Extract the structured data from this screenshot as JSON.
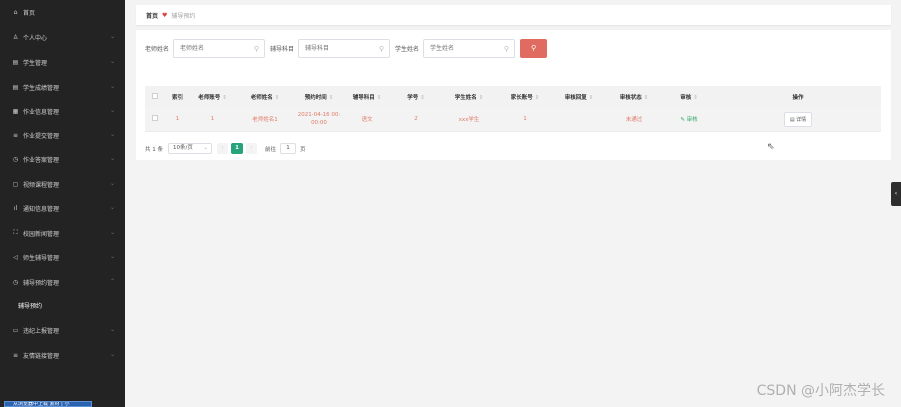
{
  "sidebar": {
    "items": [
      {
        "icon": "⌂",
        "icon_name": "home-icon",
        "label": "首页",
        "has_children": false
      },
      {
        "icon": "♙",
        "icon_name": "user-icon",
        "label": "个人中心",
        "has_children": true
      },
      {
        "icon": "▤",
        "icon_name": "list-icon",
        "label": "学生管理",
        "has_children": true
      },
      {
        "icon": "▤",
        "icon_name": "list-icon",
        "label": "学生成绩管理",
        "has_children": true
      },
      {
        "icon": "▦",
        "icon_name": "grid-icon",
        "label": "作业信息管理",
        "has_children": true
      },
      {
        "icon": "≡",
        "icon_name": "menu-icon",
        "label": "作业提交管理",
        "has_children": true
      },
      {
        "icon": "◷",
        "icon_name": "clock-icon",
        "label": "作业答案管理",
        "has_children": true
      },
      {
        "icon": "▢",
        "icon_name": "video-icon",
        "label": "视频课程管理",
        "has_children": true
      },
      {
        "icon": "ıl",
        "icon_name": "bar-chart-icon",
        "label": "通知信息管理",
        "has_children": true
      },
      {
        "icon": "⛶",
        "icon_name": "expand-icon",
        "label": "校园新闻管理",
        "has_children": true
      },
      {
        "icon": "◁",
        "icon_name": "send-icon",
        "label": "师生辅导管理",
        "has_children": true
      },
      {
        "icon": "◷",
        "icon_name": "clock-icon",
        "label": "辅导预约管理",
        "has_children": true
      },
      {
        "icon": "",
        "icon_name": "",
        "label": "辅导预约",
        "has_children": false,
        "sub": true
      },
      {
        "icon": "▭",
        "icon_name": "message-icon",
        "label": "违纪上报管理",
        "has_children": true
      },
      {
        "icon": "≡",
        "icon_name": "menu-icon",
        "label": "友情链接管理",
        "has_children": true
      }
    ],
    "taskbar_label": "从浏览器中上载 素材 | 小"
  },
  "breadcrumb": {
    "home": "首页",
    "current": "辅导预约"
  },
  "search": {
    "teacher_name_label": "老师姓名",
    "teacher_name_placeholder": "老师姓名",
    "subject_label": "辅导科目",
    "subject_placeholder": "辅导科目",
    "student_name_label": "学生姓名",
    "student_name_placeholder": "学生姓名"
  },
  "table": {
    "headers": {
      "index": "索引",
      "teacher_account": "老师账号",
      "teacher_name": "老师姓名",
      "appointment_time": "预约时间",
      "subject": "辅导科目",
      "student_no": "学号",
      "student_name": "学生姓名",
      "parent_account": "家长账号",
      "review_reply": "审核回复",
      "review_status": "审核状态",
      "review": "审核",
      "actions": "操作"
    },
    "rows": [
      {
        "index": "1",
        "teacher_account": "1",
        "teacher_name": "老师姓名1",
        "appointment_time_date": "2021-04-16 00:",
        "appointment_time_rest": "00:00",
        "subject": "语文",
        "student_no": "2",
        "student_name": "xxx学生",
        "parent_account": "1",
        "review_reply": "",
        "review_status": "未通过",
        "review_action": "✎ 审核",
        "detail_label": "▤ 详情"
      }
    ]
  },
  "pagination": {
    "total": "共 1 条",
    "page_size": "10条/页",
    "current_page": "1",
    "goto_label": "前往",
    "goto_value": "1",
    "page_suffix": "页"
  },
  "watermark": "CSDN @小阿杰学长",
  "colors": {
    "sidebar_bg": "#232323",
    "accent_red": "#e06b60",
    "row_text": "#e07a68",
    "pager_active": "#26a37a",
    "audit_green": "#3aa66a"
  }
}
